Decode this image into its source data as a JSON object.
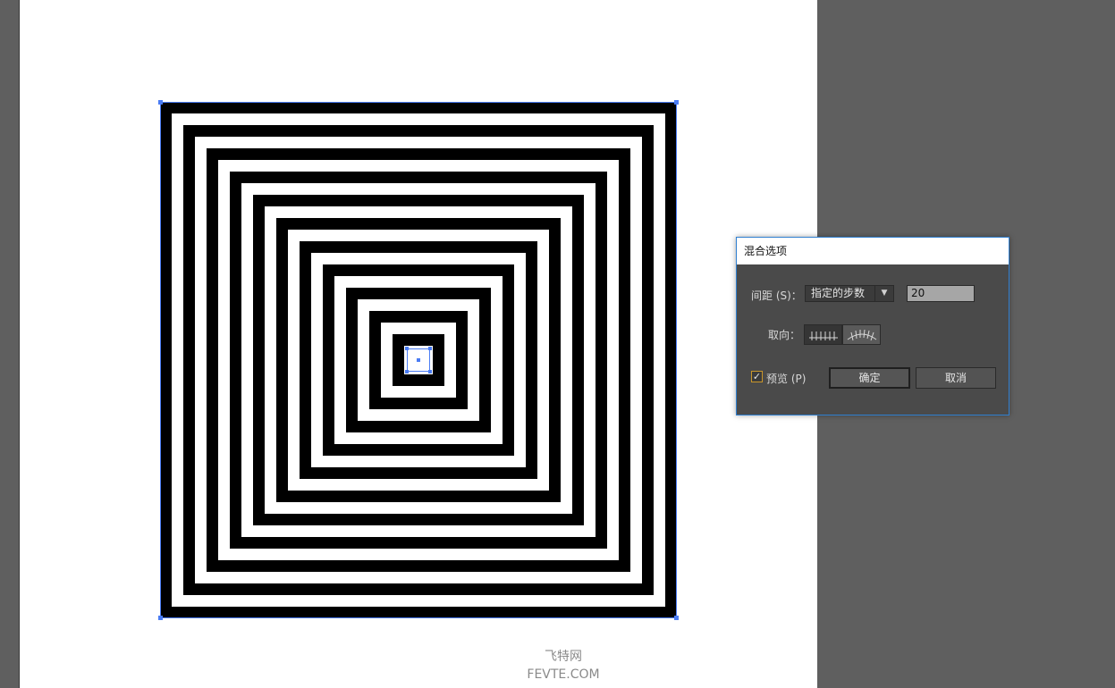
{
  "watermark": {
    "line1": "飞特网",
    "line2": "FEVTE.COM"
  },
  "artwork": {
    "description_colors": {
      "dark": "#000000",
      "light": "#ffffff",
      "selection": "#4a7cf4"
    },
    "ring_count": 22
  },
  "dialog": {
    "title": "混合选项",
    "spacing_label": "间距 (S)：",
    "spacing_selected": "指定的步数",
    "steps_value": "20",
    "orientation_label": "取向：",
    "preview_checked": true,
    "preview_label": "预览 (P)",
    "ok_label": "确定",
    "cancel_label": "取消"
  },
  "colors": {
    "canvas_bg": "#5f5f5f",
    "artboard": "#ffffff",
    "dialog_bg": "#4a4a4a",
    "dialog_border": "#2f7fd0",
    "checkbox_accent": "#c9962a"
  }
}
